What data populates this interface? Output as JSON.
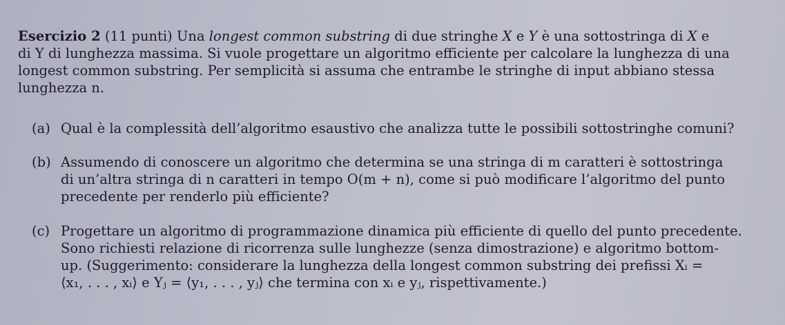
{
  "exercise": {
    "title": "Esercizio 2",
    "points": "(11 punti)",
    "intro": {
      "t1": "Una ",
      "t2_italic": "longest common substring",
      "t3": " di due stringhe ",
      "t4_X": "X",
      "t5": " e ",
      "t6_Y": "Y",
      "t7": " è una sottostringa di ",
      "t8_X": "X",
      "t9": " e",
      "line2": "di Y di lunghezza massima. Si vuole progettare un algoritmo efficiente per calcolare la lunghezza di una",
      "line3": "longest common substring. Per semplicità si assuma che entrambe le stringhe di input abbiano stessa",
      "line4": "lunghezza n."
    },
    "items": [
      {
        "label": "(a)",
        "lines": [
          "Qual è la complessità dell’algoritmo esaustivo che analizza tutte le possibili sottostringhe comuni?"
        ]
      },
      {
        "label": "(b)",
        "lines": [
          "Assumendo di conoscere un algoritmo che determina se una stringa di m caratteri è sottostringa",
          "di un’altra stringa di n caratteri in tempo O(m + n), come si può modificare l’algoritmo del punto",
          "precedente per renderlo più efficiente?"
        ]
      },
      {
        "label": "(c)",
        "lines": [
          "Progettare un algoritmo di programmazione dinamica più efficiente di quello del punto precedente.",
          "Sono richiesti relazione di ricorrenza sulle lunghezze (senza dimostrazione) e algoritmo bottom-",
          "up. (Suggerimento: considerare la lunghezza della longest common substring dei prefissi Xᵢ =",
          "⟨x₁, . . . , xᵢ⟩ e Yⱼ = ⟨y₁, . . . , yⱼ⟩ che termina con xᵢ e yⱼ, rispettivamente.)"
        ]
      }
    ]
  }
}
